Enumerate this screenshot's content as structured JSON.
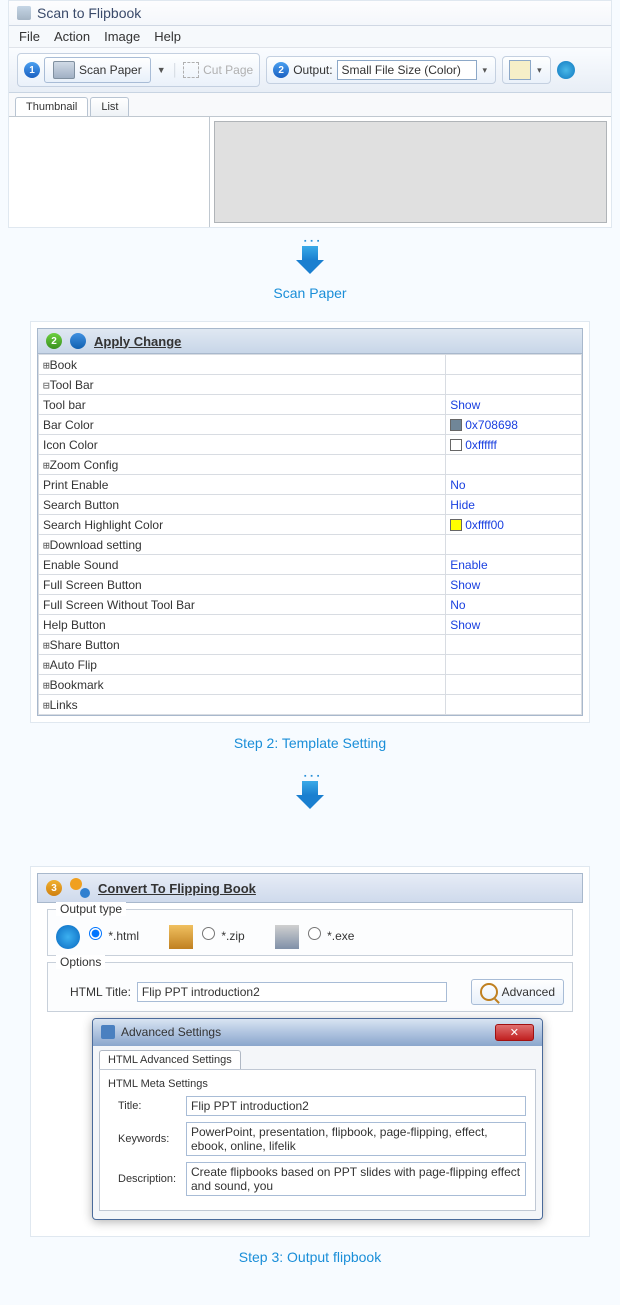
{
  "app": {
    "title": "Scan to Flipbook"
  },
  "menu": {
    "file": "File",
    "action": "Action",
    "image": "Image",
    "help": "Help"
  },
  "toolbar": {
    "badge1": "1",
    "scan_label": "Scan Paper",
    "cut_label": "Cut Page",
    "badge2": "2",
    "output_label": "Output:",
    "output_value": "Small File Size (Color)"
  },
  "tabs": {
    "thumbnail": "Thumbnail",
    "list": "List"
  },
  "caption1": "Scan Paper",
  "apply": {
    "badge": "2",
    "title": "Apply Change",
    "rows": [
      {
        "ind": "0",
        "plus": "+",
        "label": "Book",
        "val": ""
      },
      {
        "ind": "0",
        "plus": "−",
        "label": "Tool Bar",
        "val": ""
      },
      {
        "ind": "2",
        "plus": "",
        "label": "Tool bar",
        "val": "Show"
      },
      {
        "ind": "2",
        "plus": "",
        "label": "Bar Color",
        "val": "0x708698",
        "clr": "#708698"
      },
      {
        "ind": "2",
        "plus": "",
        "label": "Icon Color",
        "val": "0xffffff",
        "clr": "#ffffff"
      },
      {
        "ind": "1",
        "plus": "+",
        "label": "Zoom Config",
        "val": ""
      },
      {
        "ind": "2",
        "plus": "",
        "label": "Print Enable",
        "val": "No"
      },
      {
        "ind": "2",
        "plus": "",
        "label": "Search Button",
        "val": "Hide"
      },
      {
        "ind": "2",
        "plus": "",
        "label": "Search Highlight Color",
        "val": "0xffff00",
        "clr": "#ffff00"
      },
      {
        "ind": "1",
        "plus": "+",
        "label": "Download setting",
        "val": ""
      },
      {
        "ind": "2",
        "plus": "",
        "label": "Enable Sound",
        "val": "Enable"
      },
      {
        "ind": "2",
        "plus": "",
        "label": "Full Screen Button",
        "val": "Show"
      },
      {
        "ind": "2",
        "plus": "",
        "label": "Full Screen Without Tool Bar",
        "val": "No"
      },
      {
        "ind": "2",
        "plus": "",
        "label": "Help Button",
        "val": "Show"
      },
      {
        "ind": "1",
        "plus": "+",
        "label": "Share Button",
        "val": ""
      },
      {
        "ind": "1",
        "plus": "+",
        "label": "Auto Flip",
        "val": ""
      },
      {
        "ind": "0",
        "plus": "+",
        "label": "Bookmark",
        "val": ""
      },
      {
        "ind": "0",
        "plus": "+",
        "label": "Links",
        "val": ""
      }
    ]
  },
  "caption2": "Step 2: Template Setting",
  "convert": {
    "badge": "3",
    "title": "Convert To Flipping Book",
    "output_type_label": "Output type",
    "fmt_html": "*.html",
    "fmt_zip": "*.zip",
    "fmt_exe": "*.exe",
    "options_label": "Options",
    "html_title_label": "HTML Title:",
    "html_title_value": "Flip PPT introduction2",
    "advanced_btn": "Advanced"
  },
  "dialog": {
    "title": "Advanced Settings",
    "tab": "HTML Advanced Settings",
    "section": "HTML Meta Settings",
    "title_label": "Title:",
    "title_value": "Flip PPT introduction2",
    "keywords_label": "Keywords:",
    "keywords_value": "PowerPoint, presentation, flipbook, page-flipping, effect, ebook, online, lifelik",
    "desc_label": "Description:",
    "desc_value": "Create flipbooks based on PPT slides with page-flipping effect and sound, you"
  },
  "caption3": "Step 3: Output flipbook"
}
